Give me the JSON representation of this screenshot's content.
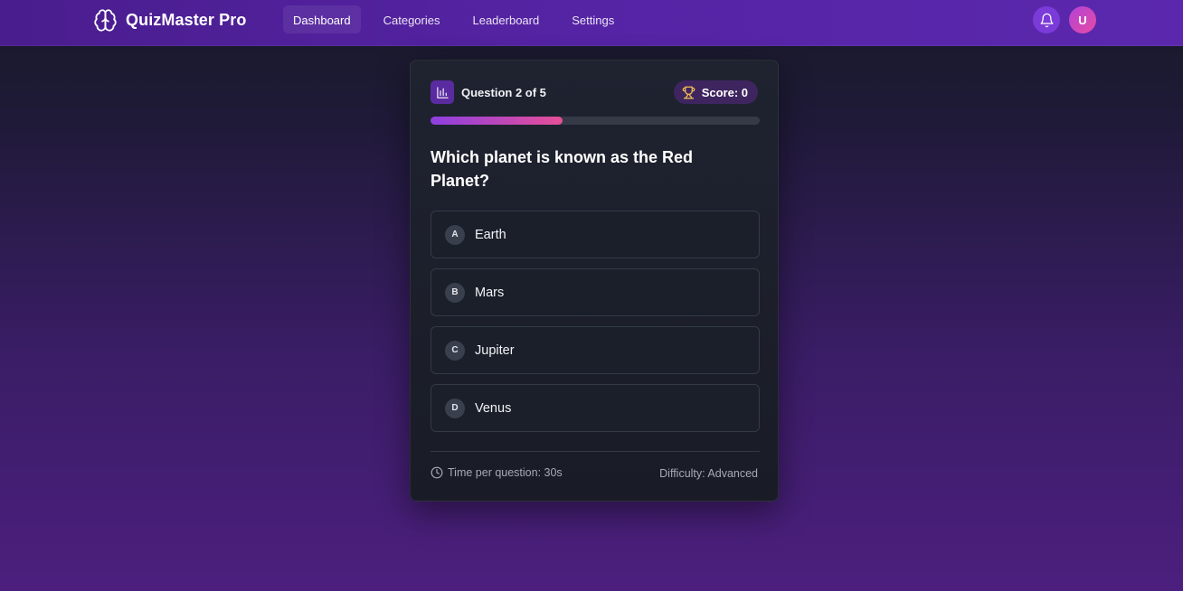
{
  "app": {
    "name": "QuizMaster Pro",
    "logo_icon": "brain-icon"
  },
  "nav": {
    "items": [
      {
        "label": "Dashboard",
        "active": true
      },
      {
        "label": "Categories",
        "active": false
      },
      {
        "label": "Leaderboard",
        "active": false
      },
      {
        "label": "Settings",
        "active": false
      }
    ],
    "bell_icon": "bell-icon",
    "avatar_initial": "U"
  },
  "quiz": {
    "question_counter": "Question 2 of 5",
    "counter_icon": "bar-chart-icon",
    "score_label": "Score: 0",
    "score_icon": "trophy-icon",
    "progress_fraction": 0.4,
    "question": "Which planet is known as the Red Planet?",
    "options": [
      {
        "letter": "A",
        "text": "Earth"
      },
      {
        "letter": "B",
        "text": "Mars"
      },
      {
        "letter": "C",
        "text": "Jupiter"
      },
      {
        "letter": "D",
        "text": "Venus"
      }
    ],
    "time_per_question": "Time per question: 30s",
    "clock_icon": "clock-icon",
    "difficulty": "Difficulty: Advanced"
  },
  "colors": {
    "nav_bg": "#5524a5",
    "accent_purple": "#8d3fe0",
    "accent_pink": "#e74f98",
    "card_bg": "#1f2330",
    "trophy": "#f2c14e"
  }
}
